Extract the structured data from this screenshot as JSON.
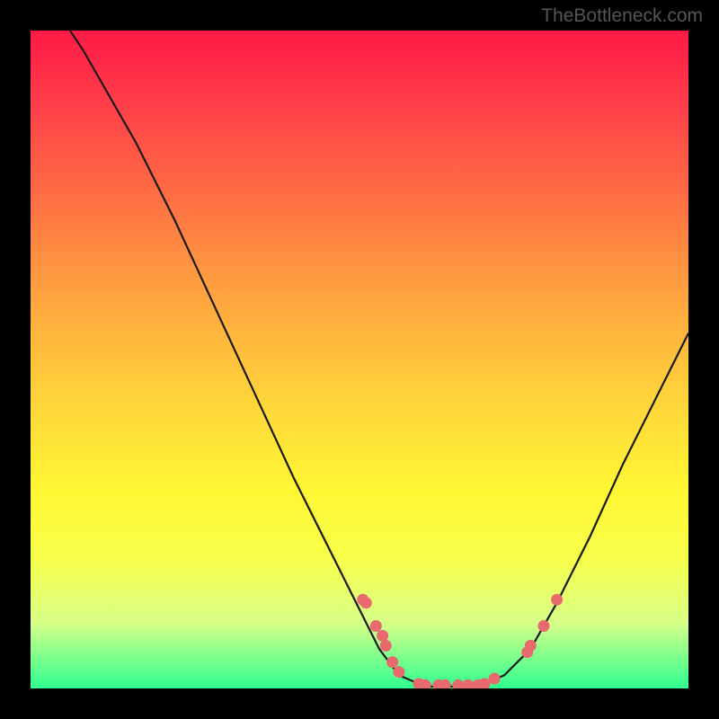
{
  "watermark": "TheBottleneck.com",
  "colors": {
    "background": "#000000",
    "gradient_top": "#ff1a45",
    "gradient_mid": "#ffd13b",
    "gradient_bottom": "#2eff90",
    "curve": "#1a1a1a",
    "dot": "#e86a6f"
  },
  "chart_data": {
    "type": "line",
    "title": "",
    "xlabel": "",
    "ylabel": "",
    "xlim": [
      0,
      100
    ],
    "ylim": [
      0,
      100
    ],
    "curve": [
      {
        "x": 6,
        "y": 100
      },
      {
        "x": 8,
        "y": 97
      },
      {
        "x": 12,
        "y": 90
      },
      {
        "x": 16,
        "y": 83
      },
      {
        "x": 22,
        "y": 71
      },
      {
        "x": 28,
        "y": 58
      },
      {
        "x": 34,
        "y": 45
      },
      {
        "x": 40,
        "y": 32
      },
      {
        "x": 46,
        "y": 20
      },
      {
        "x": 50,
        "y": 12
      },
      {
        "x": 53,
        "y": 6
      },
      {
        "x": 56,
        "y": 2
      },
      {
        "x": 60,
        "y": 0.3
      },
      {
        "x": 64,
        "y": 0.3
      },
      {
        "x": 68,
        "y": 0.3
      },
      {
        "x": 72,
        "y": 2
      },
      {
        "x": 76,
        "y": 6
      },
      {
        "x": 80,
        "y": 13
      },
      {
        "x": 85,
        "y": 23
      },
      {
        "x": 90,
        "y": 34
      },
      {
        "x": 95,
        "y": 44
      },
      {
        "x": 100,
        "y": 54
      }
    ],
    "dots": [
      {
        "x": 50.5,
        "y": 13.5
      },
      {
        "x": 51,
        "y": 13
      },
      {
        "x": 52.5,
        "y": 9.5
      },
      {
        "x": 53.5,
        "y": 8.0
      },
      {
        "x": 54,
        "y": 6.5
      },
      {
        "x": 55,
        "y": 4.0
      },
      {
        "x": 56,
        "y": 2.5
      },
      {
        "x": 59,
        "y": 0.7
      },
      {
        "x": 60,
        "y": 0.5
      },
      {
        "x": 62,
        "y": 0.5
      },
      {
        "x": 63,
        "y": 0.5
      },
      {
        "x": 65,
        "y": 0.5
      },
      {
        "x": 66.5,
        "y": 0.5
      },
      {
        "x": 68,
        "y": 0.5
      },
      {
        "x": 69,
        "y": 0.7
      },
      {
        "x": 70.5,
        "y": 1.5
      },
      {
        "x": 75.5,
        "y": 5.5
      },
      {
        "x": 76,
        "y": 6.5
      },
      {
        "x": 78,
        "y": 9.5
      },
      {
        "x": 80,
        "y": 13.5
      }
    ],
    "annotations": []
  }
}
